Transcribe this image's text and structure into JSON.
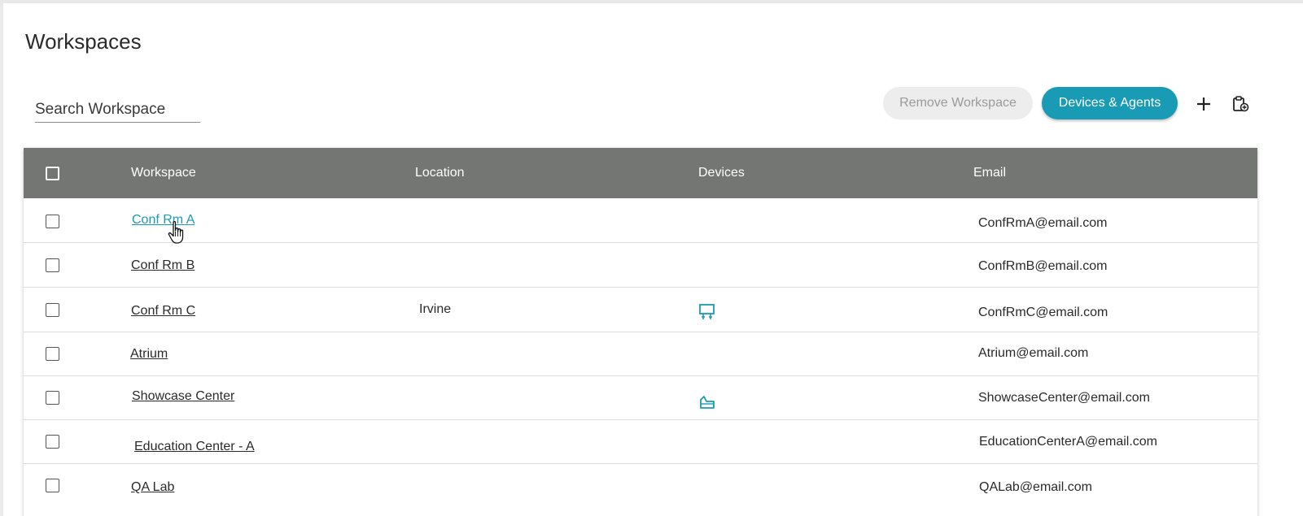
{
  "page": {
    "title": "Workspaces"
  },
  "search": {
    "placeholder": "Search Workspace"
  },
  "toolbar": {
    "remove_label": "Remove Workspace",
    "devices_label": "Devices & Agents",
    "add_icon": "plus-icon",
    "clipboard_icon": "clipboard-add-icon"
  },
  "colors": {
    "accent": "#1a9bb5",
    "header_bg": "#737672",
    "remove_bg": "#ededed"
  },
  "table": {
    "columns": [
      "Workspace",
      "Location",
      "Devices",
      "Email"
    ],
    "rows": [
      {
        "workspace": "Conf Rm A",
        "location": "",
        "device": "",
        "email": "ConfRmA@email.com"
      },
      {
        "workspace": "Conf Rm B",
        "location": "",
        "device": "",
        "email": "ConfRmB@email.com"
      },
      {
        "workspace": "Conf Rm C",
        "location": "Irvine",
        "device": "display-board-icon",
        "email": "ConfRmC@email.com"
      },
      {
        "workspace": "Atrium",
        "location": "",
        "device": "",
        "email": "Atrium@email.com"
      },
      {
        "workspace": "Showcase Center",
        "location": "",
        "device": "tablet-stand-icon",
        "email": "ShowcaseCenter@email.com"
      },
      {
        "workspace": "Education Center - A",
        "location": "",
        "device": "",
        "email": "EducationCenterA@email.com"
      },
      {
        "workspace": "QA Lab",
        "location": "",
        "device": "",
        "email": "QALab@email.com"
      }
    ]
  }
}
